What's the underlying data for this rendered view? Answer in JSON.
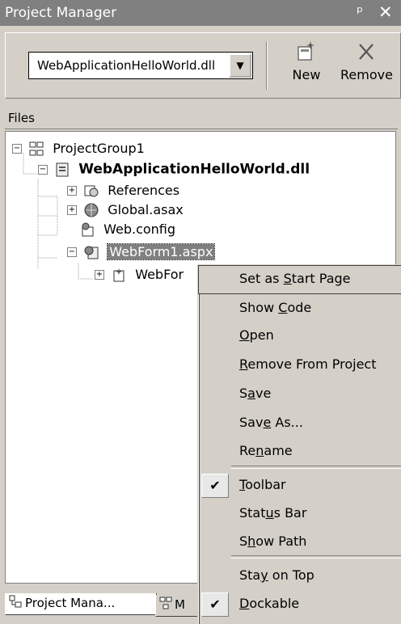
{
  "window": {
    "title": "Project Manager",
    "pin_glyph": "ᵖ",
    "close_glyph": "✕"
  },
  "toolbar": {
    "project_combo_value": "WebApplicationHelloWorld.dll",
    "new_label": "New",
    "remove_label": "Remove"
  },
  "files": {
    "header": "Files",
    "nodes": [
      {
        "label": "ProjectGroup1",
        "icon": "project-group-icon"
      },
      {
        "label": "WebApplicationHelloWorld.dll",
        "icon": "project-icon"
      },
      {
        "label": "References",
        "icon": "references-icon"
      },
      {
        "label": "Global.asax",
        "icon": "asax-file-icon"
      },
      {
        "label": "Web.config",
        "icon": "config-file-icon"
      },
      {
        "label": "WebForm1.aspx",
        "icon": "aspx-file-icon"
      },
      {
        "label": "WebFor",
        "icon": "codebehind-file-icon"
      }
    ]
  },
  "tabs": [
    {
      "label": "Project Mana..."
    },
    {
      "label": "M"
    }
  ],
  "context_menu": {
    "items": [
      {
        "pre": "Set as ",
        "key": "S",
        "post": "tart Page",
        "checked": false
      },
      {
        "pre": "Show ",
        "key": "C",
        "post": "ode",
        "checked": false
      },
      {
        "pre": "",
        "key": "O",
        "post": "pen",
        "checked": false
      },
      {
        "pre": "",
        "key": "R",
        "post": "emove From Project",
        "checked": false
      },
      {
        "pre": "S",
        "key": "a",
        "post": "ve",
        "checked": false
      },
      {
        "pre": "Sav",
        "key": "e",
        "post": " As...",
        "checked": false
      },
      {
        "pre": "Re",
        "key": "n",
        "post": "ame",
        "checked": false
      },
      {
        "pre": "",
        "key": "T",
        "post": "oolbar",
        "checked": true
      },
      {
        "pre": "Stat",
        "key": "u",
        "post": "s Bar",
        "checked": false
      },
      {
        "pre": "S",
        "key": "h",
        "post": "ow Path",
        "checked": false
      },
      {
        "pre": "Sta",
        "key": "y",
        "post": " on Top",
        "checked": false
      },
      {
        "pre": "",
        "key": "D",
        "post": "ockable",
        "checked": true
      }
    ],
    "check_glyph": "✔"
  }
}
